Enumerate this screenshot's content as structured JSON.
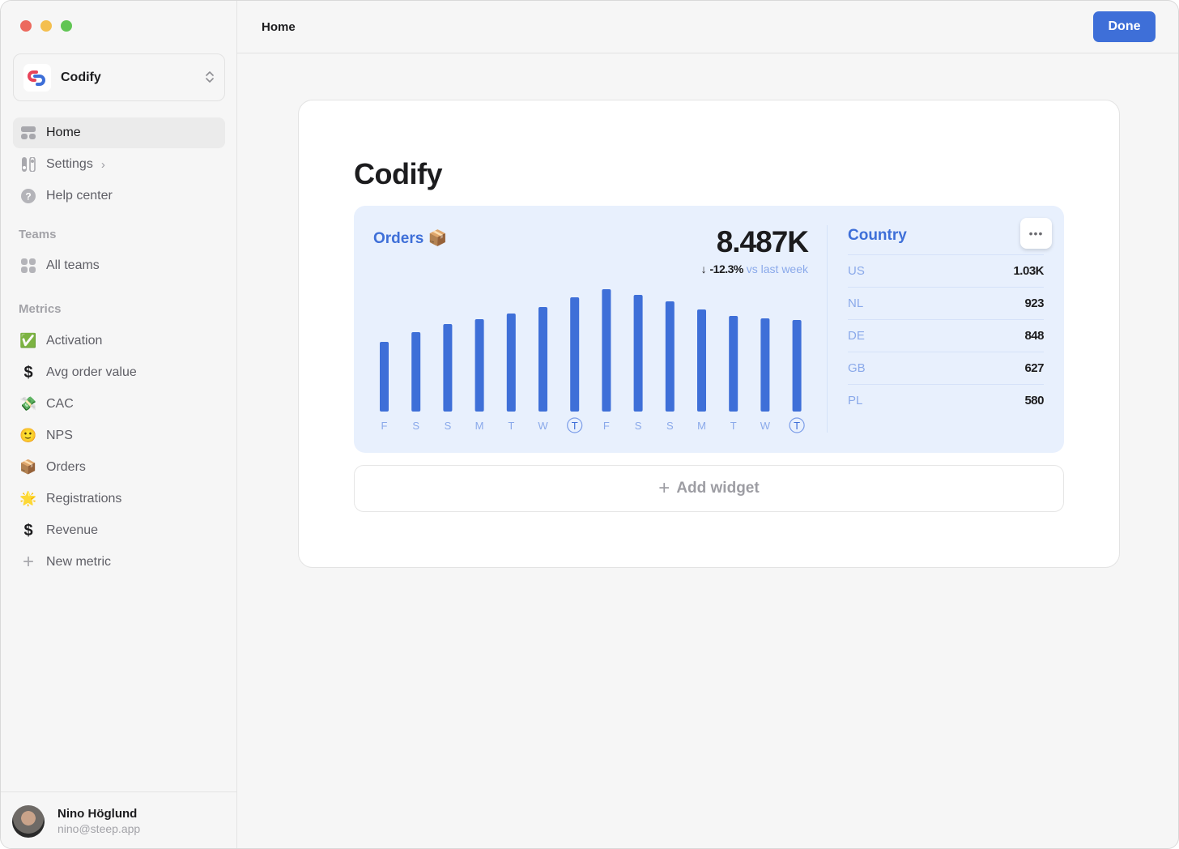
{
  "window": {
    "traffic_lights": [
      "close",
      "minimize",
      "zoom"
    ]
  },
  "sidebar": {
    "workspace": {
      "name": "Codify",
      "logo_icon": "codify-logo-icon",
      "switch_icon": "chevron-up-down-icon"
    },
    "nav": [
      {
        "label": "Home",
        "icon": "home-grid-icon",
        "active": true
      },
      {
        "label": "Settings",
        "icon": "settings-toggle-icon",
        "has_chevron": true
      },
      {
        "label": "Help center",
        "icon": "question-circle-icon"
      }
    ],
    "teams": {
      "section_label": "Teams",
      "items": [
        {
          "label": "All teams",
          "icon": "grid-icon"
        }
      ]
    },
    "metrics": {
      "section_label": "Metrics",
      "items": [
        {
          "label": "Activation",
          "icon": "✅"
        },
        {
          "label": "Avg order value",
          "icon": "$"
        },
        {
          "label": "CAC",
          "icon": "💸"
        },
        {
          "label": "NPS",
          "icon": "🙂"
        },
        {
          "label": "Orders",
          "icon": "📦"
        },
        {
          "label": "Registrations",
          "icon": "🌟"
        },
        {
          "label": "Revenue",
          "icon": "$"
        },
        {
          "label": "New metric",
          "icon": "+"
        }
      ]
    },
    "user": {
      "name": "Nino Höglund",
      "email": "nino@steep.app"
    }
  },
  "topbar": {
    "title": "Home",
    "done_label": "Done"
  },
  "main": {
    "title": "Codify",
    "widget": {
      "title": "Orders",
      "title_emoji": "📦",
      "total": "8.487K",
      "change_arrow": "↓",
      "change_value": "-12.3%",
      "change_suffix": "vs last week",
      "bar_color": "#3e6fd8",
      "country": {
        "heading": "Country",
        "more_label": "•••",
        "rows": [
          {
            "code": "US",
            "value": "1.03K"
          },
          {
            "code": "NL",
            "value": "923"
          },
          {
            "code": "DE",
            "value": "848"
          },
          {
            "code": "GB",
            "value": "627"
          },
          {
            "code": "PL",
            "value": "580"
          }
        ]
      }
    },
    "add_widget": {
      "plus": "+",
      "label": "Add widget"
    }
  },
  "chart_data": {
    "type": "bar",
    "title": "Orders",
    "categories": [
      "F",
      "S",
      "S",
      "M",
      "T",
      "W",
      "T",
      "F",
      "S",
      "S",
      "M",
      "T",
      "W",
      "T"
    ],
    "highlighted_categories": [
      6,
      13
    ],
    "values": [
      86,
      98,
      108,
      114,
      121,
      129,
      141,
      151,
      144,
      136,
      126,
      118,
      115,
      113
    ],
    "units": "relative (no y-axis shown)",
    "ylim": [
      0,
      151
    ],
    "grid": false,
    "legend": "none"
  }
}
